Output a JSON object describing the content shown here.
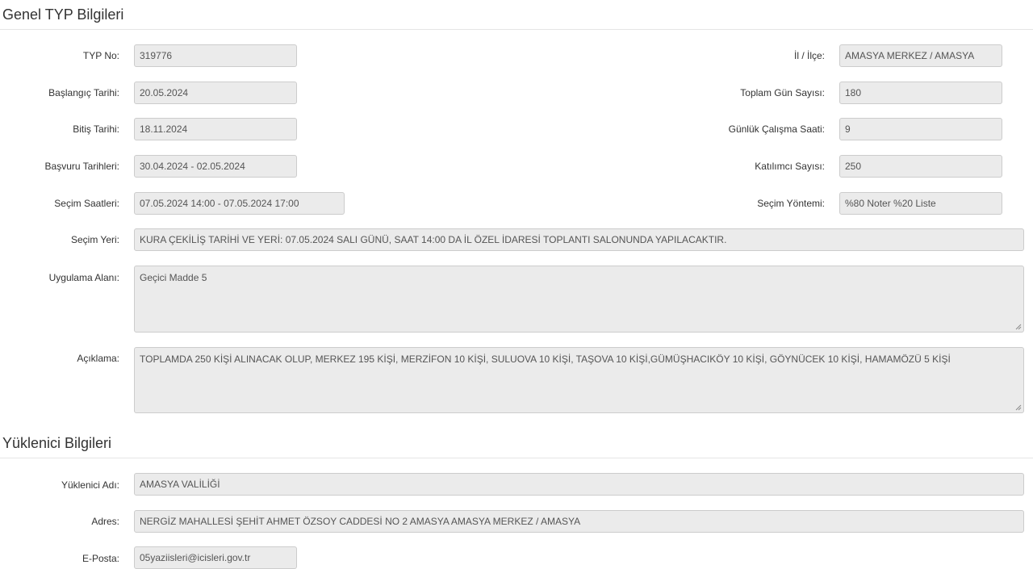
{
  "general": {
    "title": "Genel TYP Bilgileri",
    "typ_no": {
      "label": "TYP No:",
      "value": "319776"
    },
    "il_ilce": {
      "label": "İl / İlçe:",
      "value": "AMASYA MERKEZ / AMASYA"
    },
    "baslangic": {
      "label": "Başlangıç Tarihi:",
      "value": "20.05.2024"
    },
    "toplam_gun": {
      "label": "Toplam Gün Sayısı:",
      "value": "180"
    },
    "bitis": {
      "label": "Bitiş Tarihi:",
      "value": "18.11.2024"
    },
    "gunluk_saat": {
      "label": "Günlük Çalışma Saati:",
      "value": "9"
    },
    "basvuru": {
      "label": "Başvuru Tarihleri:",
      "value": "30.04.2024 - 02.05.2024"
    },
    "katilimci": {
      "label": "Katılımcı Sayısı:",
      "value": "250"
    },
    "secim_saatleri": {
      "label": "Seçim Saatleri:",
      "value": "07.05.2024 14:00 - 07.05.2024 17:00"
    },
    "secim_yontemi": {
      "label": "Seçim Yöntemi:",
      "value": "%80 Noter %20 Liste"
    },
    "secim_yeri": {
      "label": "Seçim Yeri:",
      "value": "KURA ÇEKİLİŞ TARİHİ VE YERİ: 07.05.2024 SALI  GÜNÜ, SAAT 14:00 DA  İL ÖZEL İDARESİ TOPLANTI SALONUNDA YAPILACAKTIR."
    },
    "uygulama_alani": {
      "label": "Uygulama Alanı:",
      "value": "Geçici Madde 5"
    },
    "aciklama": {
      "label": "Açıklama:",
      "value": "TOPLAMDA 250 KİŞİ ALINACAK OLUP, MERKEZ 195 KİŞİ, MERZİFON 10 KİŞİ, SULUOVA 10 KİŞİ, TAŞOVA 10 KİŞİ,GÜMÜŞHACIKÖY 10 KİŞİ, GÖYNÜCEK 10 KİŞİ, HAMAMÖZÜ 5 KİŞİ"
    }
  },
  "contractor": {
    "title": "Yüklenici Bilgileri",
    "adi": {
      "label": "Yüklenici Adı:",
      "value": "AMASYA VALİLİĞİ"
    },
    "adres": {
      "label": "Adres:",
      "value": "NERGİZ MAHALLESİ ŞEHİT AHMET ÖZSOY CADDESİ NO 2 AMASYA AMASYA MERKEZ / AMASYA"
    },
    "eposta": {
      "label": "E-Posta:",
      "value": "05yaziisleri@icisleri.gov.tr"
    }
  },
  "colors": {
    "field_bg": "#ebebeb",
    "field_border": "#cccccc",
    "text": "#333333",
    "divider": "#e5e5e5"
  },
  "icons": {
    "textarea_resize": "resize-grip-icon"
  }
}
